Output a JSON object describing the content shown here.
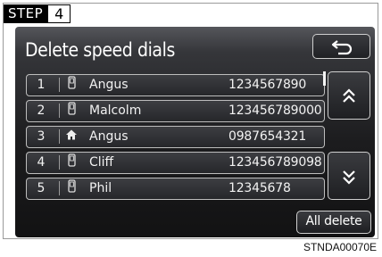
{
  "step": {
    "label": "STEP",
    "number": "4"
  },
  "screen": {
    "title": "Delete speed dials",
    "back_icon": "return-arrow-icon",
    "back_glyph": "⮌",
    "scroll_up_glyph": "˄",
    "scroll_down_glyph": "˅",
    "all_delete_label": "All delete",
    "entries": [
      {
        "index": "1",
        "icon": "mobile-phone-icon",
        "glyph": "📱",
        "name": "Angus",
        "phone": "1234567890"
      },
      {
        "index": "2",
        "icon": "mobile-phone-icon",
        "glyph": "📱",
        "name": "Malcolm",
        "phone": "123456789000"
      },
      {
        "index": "3",
        "icon": "home-icon",
        "glyph": "⌂",
        "name": "Angus",
        "phone": "0987654321"
      },
      {
        "index": "4",
        "icon": "mobile-phone-icon",
        "glyph": "📱",
        "name": "Cliff",
        "phone": "123456789098"
      },
      {
        "index": "5",
        "icon": "mobile-phone-icon",
        "glyph": "📱",
        "name": "Phil",
        "phone": "12345678"
      }
    ]
  },
  "figure_code": "STNDA00070E"
}
